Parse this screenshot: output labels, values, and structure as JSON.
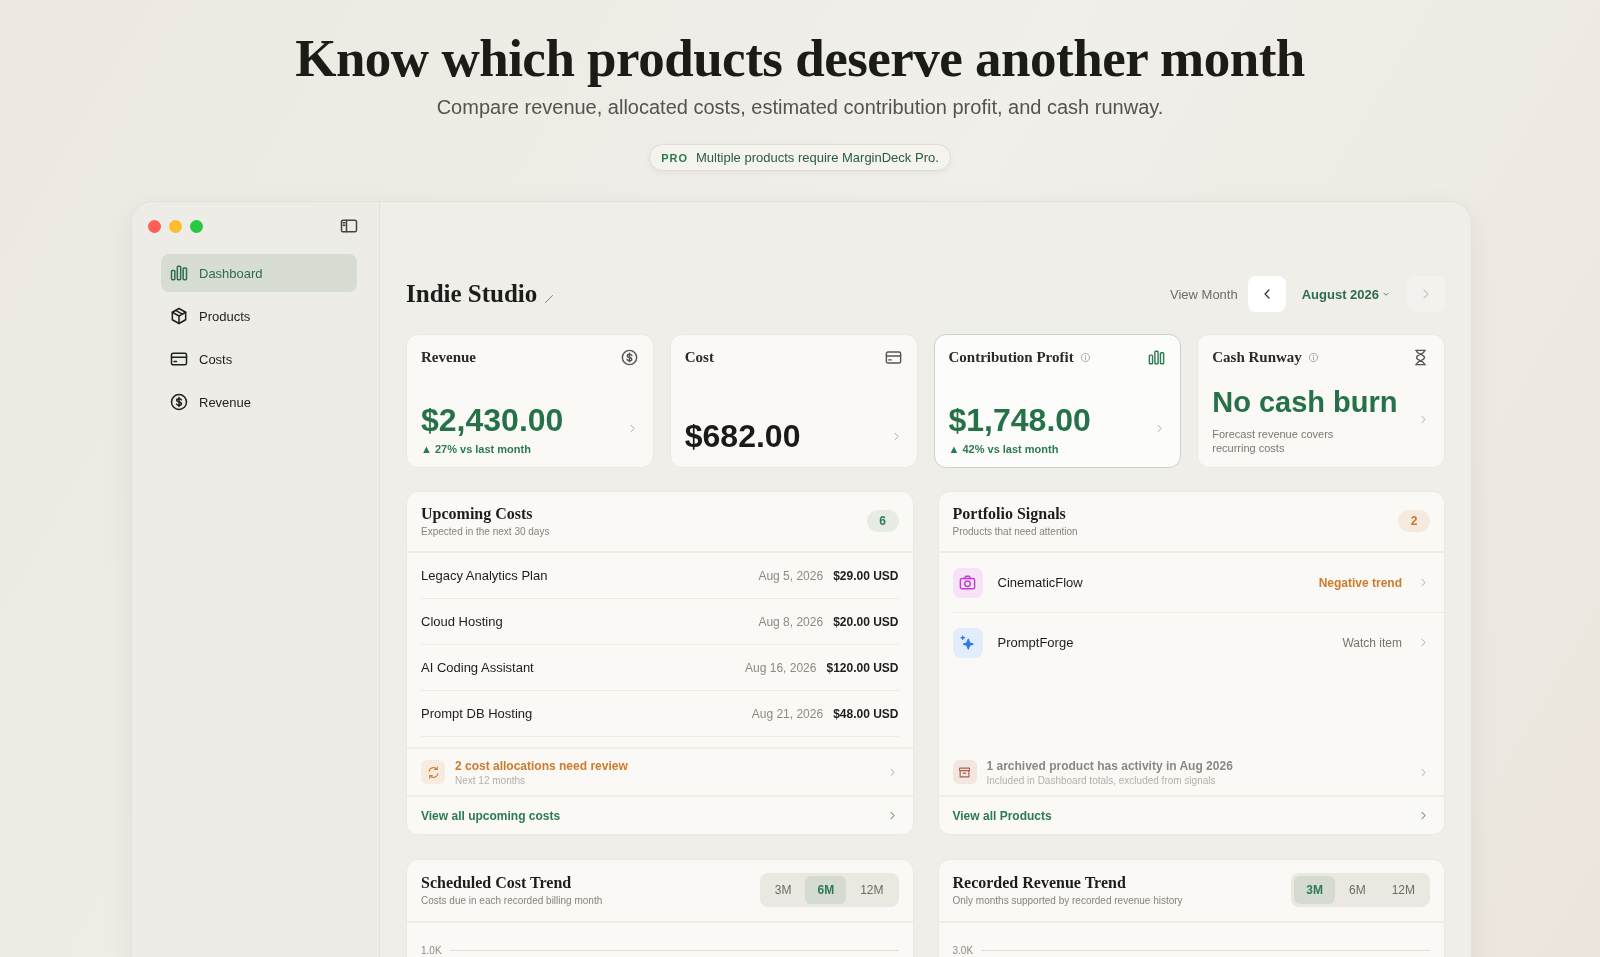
{
  "hero": {
    "title": "Know which products deserve another month",
    "subtitle": "Compare revenue, allocated costs, estimated contribution profit, and cash runway.",
    "notice": {
      "tag": "PRO",
      "text": "Multiple products require MarginDeck Pro."
    }
  },
  "sidebar": {
    "items": [
      {
        "label": "Dashboard",
        "selected": true
      },
      {
        "label": "Products",
        "selected": false
      },
      {
        "label": "Costs",
        "selected": false
      },
      {
        "label": "Revenue",
        "selected": false
      }
    ]
  },
  "workspace": {
    "title": "Indie Studio",
    "view_month_label": "View Month",
    "month": "August 2026",
    "prev_disabled": false,
    "next_disabled": true
  },
  "stats": [
    {
      "title": "Revenue",
      "info": false,
      "selected": false,
      "value": "$2,430.00",
      "positive": true,
      "change": "▲ 27% vs last month"
    },
    {
      "title": "Cost",
      "info": false,
      "selected": false,
      "value": "$682.00",
      "positive": false
    },
    {
      "title": "Contribution Profit",
      "info": true,
      "selected": true,
      "value": "$1,748.00",
      "positive": true,
      "change": "▲ 42% vs last month"
    },
    {
      "title": "Cash Runway",
      "info": true,
      "selected": false,
      "value": "No cash burn",
      "positive": true,
      "note": "Forecast revenue covers recurring costs"
    }
  ],
  "upcoming_costs": {
    "title": "Upcoming Costs",
    "subtitle": "Expected in the next 30 days",
    "count": "6",
    "rows": [
      {
        "name": "Legacy Analytics Plan",
        "date": "Aug 5, 2026",
        "amount": "$29.00 USD"
      },
      {
        "name": "Cloud Hosting",
        "date": "Aug 8, 2026",
        "amount": "$20.00 USD"
      },
      {
        "name": "AI Coding Assistant",
        "date": "Aug 16, 2026",
        "amount": "$120.00 USD"
      },
      {
        "name": "Prompt DB Hosting",
        "date": "Aug 21, 2026",
        "amount": "$48.00 USD"
      }
    ],
    "alert": {
      "title": "2 cost allocations need review",
      "subtitle": "Next 12 months"
    },
    "link": "View all upcoming costs"
  },
  "portfolio_signals": {
    "title": "Portfolio Signals",
    "subtitle": "Products that need attention",
    "count": "2",
    "items": [
      {
        "name": "CinematicFlow",
        "status": "Negative trend",
        "warning": true
      },
      {
        "name": "PromptForge",
        "status": "Watch item",
        "warning": false
      }
    ],
    "notice": {
      "title": "1 archived product has activity in Aug 2026",
      "subtitle": "Included in Dashboard totals, excluded from signals"
    },
    "link": "View all Products"
  },
  "trends": [
    {
      "title": "Scheduled Cost Trend",
      "subtitle": "Costs due in each recorded billing month",
      "tick": "1.0K",
      "ranges": [
        {
          "label": "3M",
          "selected": false
        },
        {
          "label": "6M",
          "selected": true
        },
        {
          "label": "12M",
          "selected": false
        }
      ]
    },
    {
      "title": "Recorded Revenue Trend",
      "subtitle": "Only months supported by recorded revenue history",
      "tick": "3.0K",
      "ranges": [
        {
          "label": "3M",
          "selected": true
        },
        {
          "label": "6M",
          "selected": false
        },
        {
          "label": "12M",
          "selected": false
        }
      ]
    }
  ]
}
